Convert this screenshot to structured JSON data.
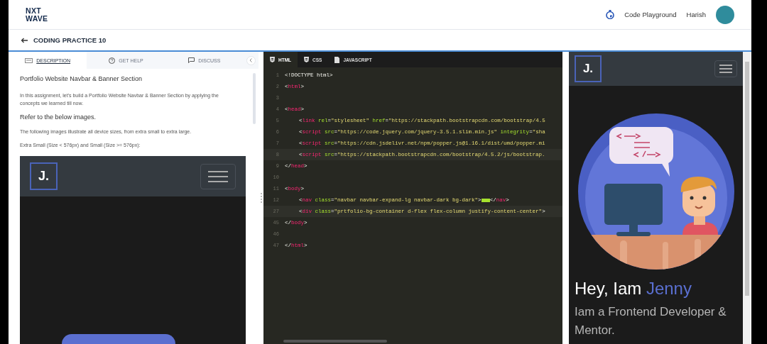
{
  "header": {
    "logo": [
      "NXT",
      "WAVE"
    ],
    "link": "Code Playground",
    "user": "Harish"
  },
  "page_title": "CODING PRACTICE 10",
  "description": {
    "tabs": [
      {
        "label": "DESCRIPTION",
        "kind": "description",
        "selected": true
      },
      {
        "label": "GET HELP",
        "kind": "help",
        "selected": false
      },
      {
        "label": "DISCUSS",
        "kind": "discuss",
        "selected": false
      }
    ],
    "content": [
      {
        "kind": "title",
        "text": "Portfolio Website Navbar & Banner Section"
      },
      {
        "kind": "paragraph",
        "text": "In this assignment, let's build a Portfolio Website Navbar & Banner Section by applying the concepts we learned till now."
      },
      {
        "kind": "subheading",
        "text": "Refer to the below images."
      },
      {
        "kind": "paragraph",
        "text": "The following images illustrate all device sizes, from extra small to extra large."
      },
      {
        "kind": "paragraph",
        "text": "Extra Small (Size < 576px) and Small (Size >= 576px):"
      }
    ],
    "sample_logo": "J."
  },
  "editor": {
    "tabs": [
      {
        "label": "HTML",
        "kind": "html",
        "selected": true
      },
      {
        "label": "CSS",
        "kind": "css",
        "selected": false
      },
      {
        "label": "JAVASCRIPT",
        "kind": "js",
        "selected": false
      }
    ],
    "lines": [
      {
        "number": "1",
        "tokens": [
          {
            "kind": "text",
            "text": "<!DOCTYPE html>"
          }
        ]
      },
      {
        "number": "2",
        "tokens": [
          {
            "kind": "punct",
            "text": "<"
          },
          {
            "kind": "tag",
            "text": "html"
          },
          {
            "kind": "punct",
            "text": ">"
          }
        ]
      },
      {
        "number": "3"
      },
      {
        "number": "4",
        "tokens": [
          {
            "kind": "punct",
            "text": "<"
          },
          {
            "kind": "tag",
            "text": "head"
          },
          {
            "kind": "punct",
            "text": ">"
          }
        ],
        "children": [
          {
            "number": "5",
            "tokens": [
              {
                "kind": "punct",
                "text": "<"
              },
              {
                "kind": "tag",
                "text": "link"
              },
              {
                "kind": "attr",
                "text": " rel"
              },
              {
                "kind": "punct",
                "text": "="
              },
              {
                "kind": "string",
                "text": "\"stylesheet\""
              },
              {
                "kind": "attr",
                "text": " href"
              },
              {
                "kind": "punct",
                "text": "="
              },
              {
                "kind": "string",
                "text": "\"https://stackpath.bootstrapcdn.com/bootstrap/4.5"
              }
            ]
          },
          {
            "number": "6",
            "tokens": [
              {
                "kind": "punct",
                "text": "<"
              },
              {
                "kind": "tag",
                "text": "script"
              },
              {
                "kind": "attr",
                "text": " src"
              },
              {
                "kind": "punct",
                "text": "="
              },
              {
                "kind": "string",
                "text": "\"https://code.jquery.com/jquery-3.5.1.slim.min.js\""
              },
              {
                "kind": "attr",
                "text": " integrity"
              },
              {
                "kind": "punct",
                "text": "="
              },
              {
                "kind": "string",
                "text": "\"sha"
              }
            ]
          },
          {
            "number": "7",
            "tokens": [
              {
                "kind": "punct",
                "text": "<"
              },
              {
                "kind": "tag",
                "text": "script"
              },
              {
                "kind": "attr",
                "text": " src"
              },
              {
                "kind": "punct",
                "text": "="
              },
              {
                "kind": "string",
                "text": "\"https://cdn.jsdelivr.net/npm/popper.js@1.16.1/dist/umd/popper.mi"
              }
            ]
          },
          {
            "number": "8",
            "tokens": [
              {
                "kind": "punct",
                "text": "<"
              },
              {
                "kind": "tag",
                "text": "script"
              },
              {
                "kind": "attr",
                "text": " src"
              },
              {
                "kind": "punct",
                "text": "="
              },
              {
                "kind": "string",
                "text": "\"https://stackpath.bootstrapcdn.com/bootstrap/4.5.2/js/bootstrap."
              }
            ]
          }
        ]
      },
      {
        "number": "9",
        "tokens": [
          {
            "kind": "punct",
            "text": "</"
          },
          {
            "kind": "tag",
            "text": "head"
          },
          {
            "kind": "punct",
            "text": ">"
          }
        ]
      },
      {
        "number": "10"
      },
      {
        "number": "11",
        "tokens": [
          {
            "kind": "punct",
            "text": "<"
          },
          {
            "kind": "tag",
            "text": "body"
          },
          {
            "kind": "punct",
            "text": ">"
          }
        ],
        "children": [
          {
            "number": "12",
            "tokens": [
              {
                "kind": "punct",
                "text": "<"
              },
              {
                "kind": "tag",
                "text": "nav"
              },
              {
                "kind": "attr",
                "text": " class"
              },
              {
                "kind": "punct",
                "text": "="
              },
              {
                "kind": "string",
                "text": "\"navbar navbar-expand-lg navbar-dark bg-dark\""
              },
              {
                "kind": "punct",
                "text": ">"
              },
              {
                "kind": "fold"
              },
              {
                "kind": "punct",
                "text": "</"
              },
              {
                "kind": "tag",
                "text": "nav"
              },
              {
                "kind": "punct",
                "text": ">"
              }
            ]
          },
          {
            "number": "27",
            "tokens": [
              {
                "kind": "punct",
                "text": "<"
              },
              {
                "kind": "tag",
                "text": "div"
              },
              {
                "kind": "attr",
                "text": " class"
              },
              {
                "kind": "punct",
                "text": "="
              },
              {
                "kind": "string",
                "text": "\"prtfolio-bg-container d-flex flex-column justify-content-center\""
              },
              {
                "kind": "punct",
                "text": ">"
              }
            ]
          }
        ]
      },
      {
        "number": "45",
        "tokens": [
          {
            "kind": "punct",
            "text": "</"
          },
          {
            "kind": "tag",
            "text": "body"
          },
          {
            "kind": "punct",
            "text": ">"
          }
        ]
      },
      {
        "number": "46"
      },
      {
        "number": "47",
        "tokens": [
          {
            "kind": "punct",
            "text": "</"
          },
          {
            "kind": "tag",
            "text": "html"
          },
          {
            "kind": "punct",
            "text": ">"
          }
        ]
      }
    ]
  },
  "preview": {
    "logo": "J.",
    "greeting": "Hey, Iam",
    "name": "Jenny",
    "subtitle": "Iam a Frontend Developer & Mentor."
  }
}
